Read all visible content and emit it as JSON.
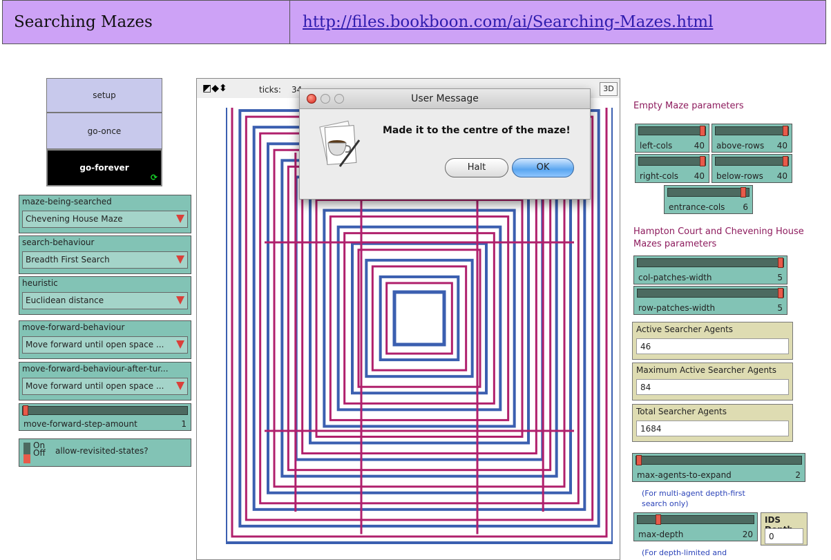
{
  "header": {
    "title": "Searching Mazes",
    "link": "http://files.bookboon.com/ai/Searching-Mazes.html"
  },
  "buttons": {
    "setup": "setup",
    "go_once": "go-once",
    "go_forever": "go-forever"
  },
  "choosers": [
    {
      "label": "maze-being-searched",
      "value": "Chevening House Maze"
    },
    {
      "label": "search-behaviour",
      "value": "Breadth First Search"
    },
    {
      "label": "heuristic",
      "value": "Euclidean distance"
    },
    {
      "label": "move-forward-behaviour",
      "value": "Move forward until open space ..."
    },
    {
      "label": "move-forward-behaviour-after-tur...",
      "value": "Move forward until open space ..."
    }
  ],
  "step_slider": {
    "label": "move-forward-step-amount",
    "value": "1"
  },
  "revisit_switch": {
    "on": "On",
    "off": "Off",
    "label": "allow-revisited-states?"
  },
  "world": {
    "ticks_label": "ticks:",
    "ticks_value": "34",
    "view3d": "3D"
  },
  "dialog": {
    "title": "User Message",
    "message": "Made it to the centre of the maze!",
    "halt": "Halt",
    "ok": "OK"
  },
  "right": {
    "empty_heading": "Empty Maze parameters",
    "left_cols": {
      "label": "left-cols",
      "value": "40"
    },
    "above_rows": {
      "label": "above-rows",
      "value": "40"
    },
    "right_cols": {
      "label": "right-cols",
      "value": "40"
    },
    "below_rows": {
      "label": "below-rows",
      "value": "40"
    },
    "entrance_cols": {
      "label": "entrance-cols",
      "value": "6"
    },
    "hc_heading_1": "Hampton Court and Chevening House",
    "hc_heading_2": "Mazes parameters",
    "col_patches": {
      "label": "col-patches-width",
      "value": "5"
    },
    "row_patches": {
      "label": "row-patches-width",
      "value": "5"
    },
    "active": {
      "label": "Active Searcher Agents",
      "value": "46"
    },
    "max_active": {
      "label": "Maximum Active Searcher Agents",
      "value": "84"
    },
    "total": {
      "label": "Total Searcher Agents",
      "value": "1684"
    },
    "max_expand": {
      "label": "max-agents-to-expand",
      "value": "2"
    },
    "note_multi_1": "(For multi-agent depth-first",
    "note_multi_2": "search only)",
    "max_depth": {
      "label": "max-depth",
      "value": "20"
    },
    "ids": {
      "label": "IDS Depth",
      "value": "0"
    },
    "note_depth": "(For depth-limited and"
  },
  "colors": {
    "header_bg": "#cda2f6",
    "widget_green": "#82c3b5",
    "button_lavender": "#c8c9ec",
    "monitor_bg": "#dedcb2",
    "maze_wall": "#3b5fb0",
    "maze_path": "#b0206c"
  }
}
